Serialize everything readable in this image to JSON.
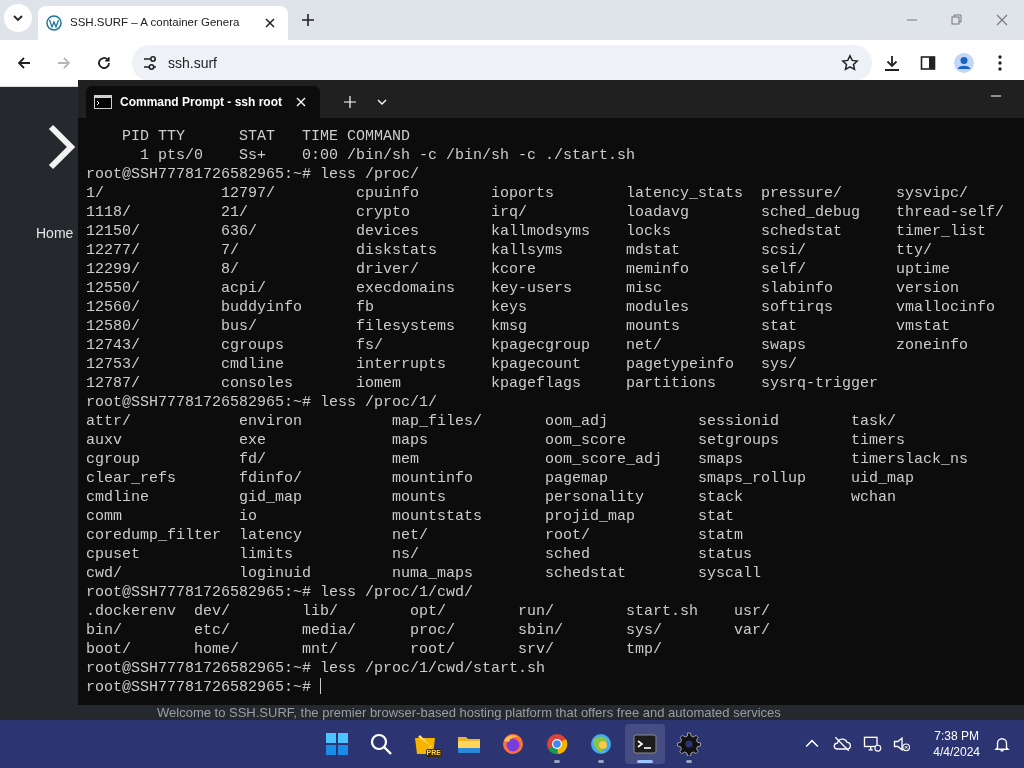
{
  "browser": {
    "tab": {
      "title": "SSH.SURF – A container Genera",
      "selected": true
    },
    "address": "ssh.surf",
    "back_disabled": false,
    "forward_disabled": true
  },
  "page": {
    "nav_label": "Home",
    "welcome_text": "Welcome to SSH.SURF, the premier browser-based hosting platform that offers free and automated services"
  },
  "terminal": {
    "tab_title": "Command Prompt - ssh root",
    "blocks": [
      {
        "kind": "text",
        "lines": [
          "    PID TTY      STAT   TIME COMMAND",
          "      1 pts/0    Ss+    0:00 /bin/sh -c /bin/sh -c ./start.sh"
        ]
      },
      {
        "kind": "prompt",
        "prompt": "root@SSH77781726582965:~#",
        "command": "less /proc/",
        "cursor": false
      },
      {
        "kind": "listing",
        "rows": [
          [
            "1/",
            "12797/",
            "cpuinfo",
            "ioports",
            "latency_stats",
            "pressure/",
            "sysvipc/"
          ],
          [
            "1118/",
            "21/",
            "crypto",
            "irq/",
            "loadavg",
            "sched_debug",
            "thread-self/"
          ],
          [
            "12150/",
            "636/",
            "devices",
            "kallmodsyms",
            "locks",
            "schedstat",
            "timer_list"
          ],
          [
            "12277/",
            "7/",
            "diskstats",
            "kallsyms",
            "mdstat",
            "scsi/",
            "tty/"
          ],
          [
            "12299/",
            "8/",
            "driver/",
            "kcore",
            "meminfo",
            "self/",
            "uptime"
          ],
          [
            "12550/",
            "acpi/",
            "execdomains",
            "key-users",
            "misc",
            "slabinfo",
            "version"
          ],
          [
            "12560/",
            "buddyinfo",
            "fb",
            "keys",
            "modules",
            "softirqs",
            "vmallocinfo"
          ],
          [
            "12580/",
            "bus/",
            "filesystems",
            "kmsg",
            "mounts",
            "stat",
            "vmstat"
          ],
          [
            "12743/",
            "cgroups",
            "fs/",
            "kpagecgroup",
            "net/",
            "swaps",
            "zoneinfo"
          ],
          [
            "12753/",
            "cmdline",
            "interrupts",
            "kpagecount",
            "pagetypeinfo",
            "sys/"
          ],
          [
            "12787/",
            "consoles",
            "iomem",
            "kpageflags",
            "partitions",
            "sysrq-trigger"
          ]
        ]
      },
      {
        "kind": "prompt",
        "prompt": "root@SSH77781726582965:~#",
        "command": "less /proc/1/",
        "cursor": false
      },
      {
        "kind": "listing",
        "rows": [
          [
            "attr/",
            "environ",
            "map_files/",
            "oom_adj",
            "sessionid",
            "task/"
          ],
          [
            "auxv",
            "exe",
            "maps",
            "oom_score",
            "setgroups",
            "timers"
          ],
          [
            "cgroup",
            "fd/",
            "mem",
            "oom_score_adj",
            "smaps",
            "timerslack_ns"
          ],
          [
            "clear_refs",
            "fdinfo/",
            "mountinfo",
            "pagemap",
            "smaps_rollup",
            "uid_map"
          ],
          [
            "cmdline",
            "gid_map",
            "mounts",
            "personality",
            "stack",
            "wchan"
          ],
          [
            "comm",
            "io",
            "mountstats",
            "projid_map",
            "stat"
          ],
          [
            "coredump_filter",
            "latency",
            "net/",
            "root/",
            "statm"
          ],
          [
            "cpuset",
            "limits",
            "ns/",
            "sched",
            "status"
          ],
          [
            "cwd/",
            "loginuid",
            "numa_maps",
            "schedstat",
            "syscall"
          ]
        ]
      },
      {
        "kind": "prompt",
        "prompt": "root@SSH77781726582965:~#",
        "command": "less /proc/1/cwd/",
        "cursor": false
      },
      {
        "kind": "listing",
        "rows": [
          [
            ".dockerenv",
            "dev/",
            "lib/",
            "opt/",
            "run/",
            "start.sh",
            "usr/"
          ],
          [
            "bin/",
            "etc/",
            "media/",
            "proc/",
            "sbin/",
            "sys/",
            "var/"
          ],
          [
            "boot/",
            "home/",
            "mnt/",
            "root/",
            "srv/",
            "tmp/"
          ]
        ]
      },
      {
        "kind": "prompt",
        "prompt": "root@SSH77781726582965:~#",
        "command": "less /proc/1/cwd/start.sh",
        "cursor": false
      },
      {
        "kind": "prompt",
        "prompt": "root@SSH77781726582965:~#",
        "cursor": true
      }
    ]
  },
  "taskbar": {
    "apps": [
      {
        "kind": "start",
        "running": false,
        "selected": false
      },
      {
        "kind": "search",
        "running": false,
        "selected": false
      },
      {
        "kind": "pre_app",
        "badge": "PRE",
        "running": false,
        "selected": false
      },
      {
        "kind": "folder",
        "running": false,
        "selected": false
      },
      {
        "kind": "fox_browser",
        "running": false,
        "selected": false
      },
      {
        "kind": "ring_browser",
        "running": true,
        "selected": false
      },
      {
        "kind": "globe_browser",
        "running": true,
        "selected": false
      },
      {
        "kind": "terminal",
        "running": true,
        "selected": true
      },
      {
        "kind": "gear",
        "running": true,
        "selected": false
      }
    ],
    "tray": [
      {
        "kind": "chevron"
      },
      {
        "kind": "cloud_off"
      },
      {
        "kind": "network"
      },
      {
        "kind": "volume_off"
      }
    ],
    "time": "7:38 PM",
    "date": "4/4/2024"
  }
}
